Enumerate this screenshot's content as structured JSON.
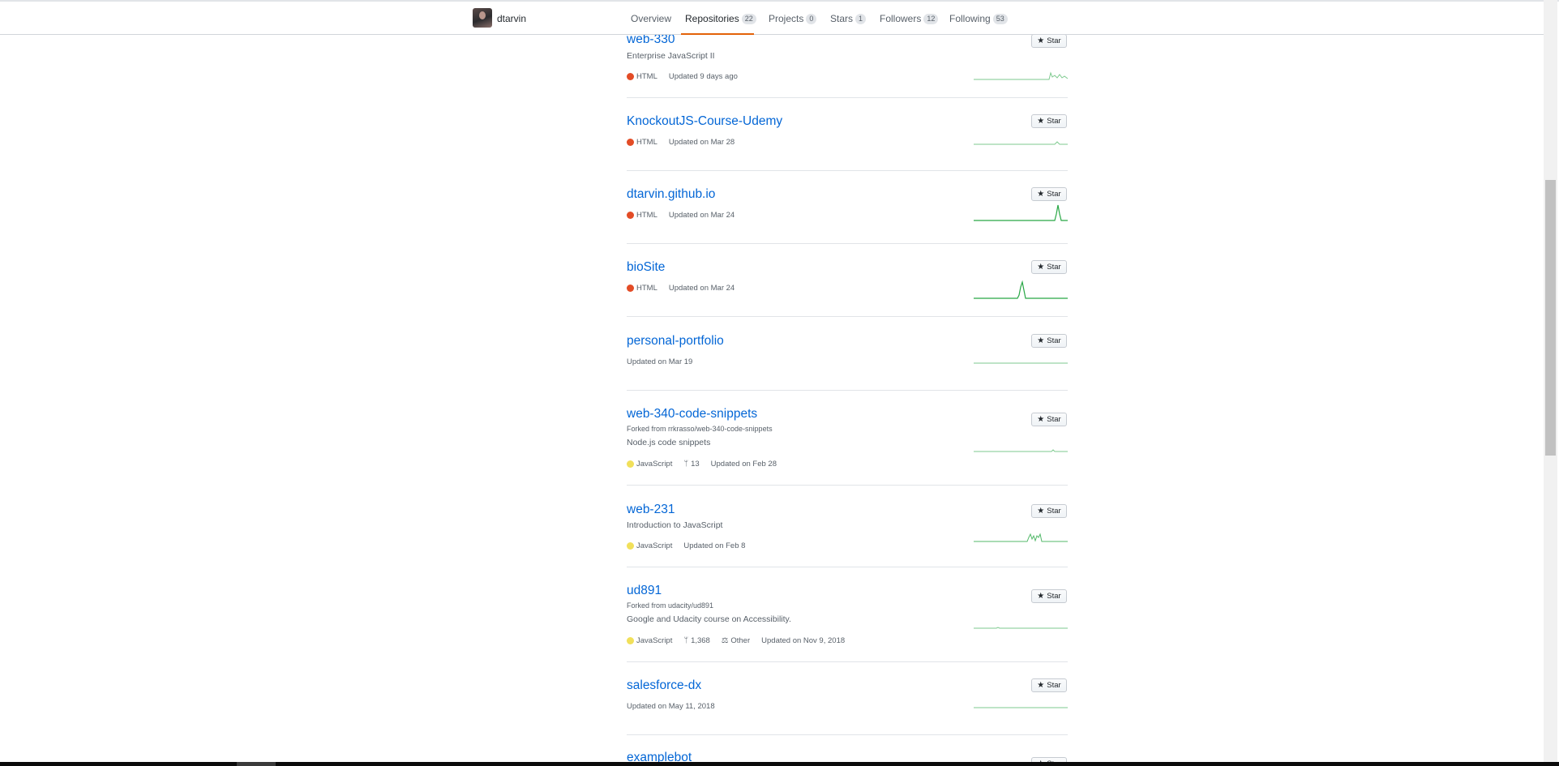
{
  "header": {
    "username": "dtarvin",
    "tabs": [
      {
        "label": "Overview",
        "count": null
      },
      {
        "label": "Repositories",
        "count": "22"
      },
      {
        "label": "Projects",
        "count": "0"
      },
      {
        "label": "Stars",
        "count": "1"
      },
      {
        "label": "Followers",
        "count": "12"
      },
      {
        "label": "Following",
        "count": "53"
      }
    ],
    "active_tab": "Repositories",
    "accent_color": "#e36209"
  },
  "star_label": "Star",
  "colors": {
    "link": "#0366d6",
    "html": "#e34c26",
    "javascript": "#f1e05a",
    "sparkline": "#28a745"
  },
  "repos": [
    {
      "name": "web-330",
      "desc": "Enterprise JavaScript II",
      "lang": "HTML",
      "updated": "Updated 9 days ago"
    },
    {
      "name": "KnockoutJS-Course-Udemy",
      "lang": "HTML",
      "updated": "Updated on Mar 28"
    },
    {
      "name": "dtarvin.github.io",
      "lang": "HTML",
      "updated": "Updated on Mar 24"
    },
    {
      "name": "bioSite",
      "lang": "HTML",
      "updated": "Updated on Mar 24"
    },
    {
      "name": "personal-portfolio",
      "updated": "Updated on Mar 19"
    },
    {
      "name": "web-340-code-snippets",
      "forked": "Forked from rrkrasso/web-340-code-snippets",
      "desc": "Node.js code snippets",
      "lang": "JavaScript",
      "forks": "13",
      "updated": "Updated on Feb 28"
    },
    {
      "name": "web-231",
      "desc": "Introduction to JavaScript",
      "lang": "JavaScript",
      "updated": "Updated on Feb 8"
    },
    {
      "name": "ud891",
      "forked": "Forked from udacity/ud891",
      "desc": "Google and Udacity course on Accessibility.",
      "lang": "JavaScript",
      "forks": "1,368",
      "license": "Other",
      "updated": "Updated on Nov 9, 2018"
    },
    {
      "name": "salesforce-dx",
      "updated": "Updated on May 11, 2018"
    },
    {
      "name": "examplebot"
    }
  ]
}
